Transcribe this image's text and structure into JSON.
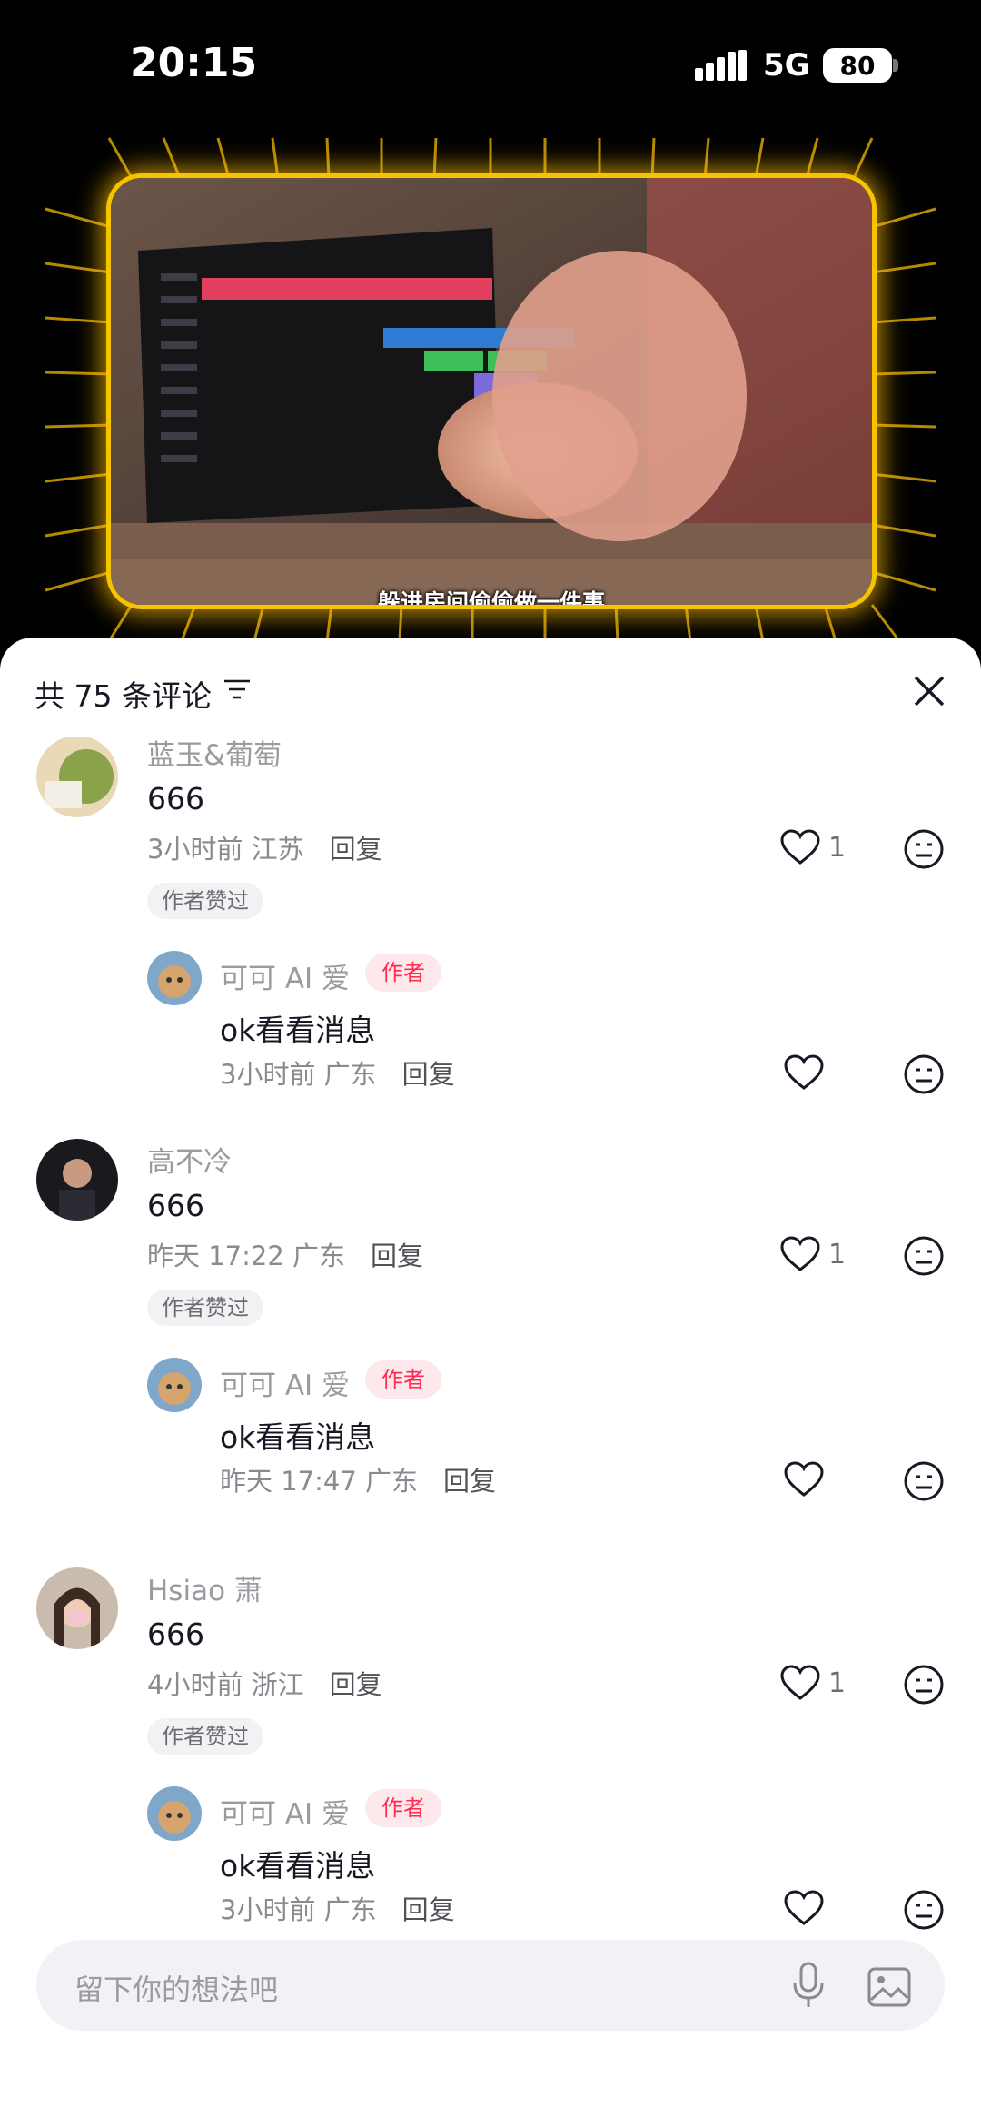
{
  "status_bar": {
    "time": "20:15",
    "network": "5G",
    "battery": "80"
  },
  "video": {
    "subtitle": "躲进房间偷偷做一件事"
  },
  "comments_header": {
    "title": "共 75 条评论"
  },
  "comments": [
    {
      "author": "蓝玉&葡萄",
      "text": "666",
      "meta": "3小时前 江苏",
      "reply": "回复",
      "likes": "1",
      "liked_badge": "作者赞过",
      "reply_item": {
        "author": "可可 AI 爱",
        "tag": "作者",
        "text": "ok看看消息",
        "meta": "3小时前 广东",
        "reply": "回复"
      }
    },
    {
      "author": "高不冷",
      "text": "666",
      "meta": "昨天 17:22 广东",
      "reply": "回复",
      "likes": "1",
      "liked_badge": "作者赞过",
      "reply_item": {
        "author": "可可 AI 爱",
        "tag": "作者",
        "text": "ok看看消息",
        "meta": "昨天 17:47 广东",
        "reply": "回复"
      }
    },
    {
      "author": "Hsiao 萧",
      "text": "666",
      "meta": "4小时前 浙江",
      "reply": "回复",
      "likes": "1",
      "liked_badge": "作者赞过",
      "reply_item": {
        "author": "可可 AI 爱",
        "tag": "作者",
        "text": "ok看看消息",
        "meta": "3小时前 广东",
        "reply": "回复"
      }
    }
  ],
  "input": {
    "placeholder": "留下你的想法吧"
  },
  "icons": {
    "filter": "filter-icon",
    "close": "close-icon",
    "like": "heart-icon",
    "emoji": "emoji-icon",
    "mic": "mic-icon",
    "image": "image-icon"
  },
  "colors": {
    "accent": "#fe2c55",
    "glow": "#f5c400"
  }
}
